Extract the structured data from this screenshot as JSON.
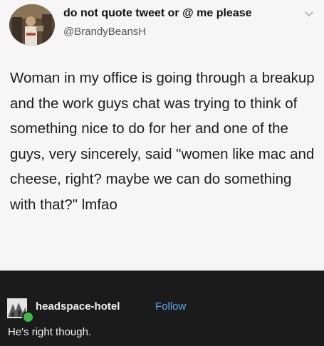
{
  "tweet": {
    "display_name": "do not quote tweet or @ me please",
    "handle": "@BrandyBeansH",
    "text": "Woman in my office is going through a breakup and the work guys chat was trying to think of something nice to do for her and one of the guys, very sincerely, said \"women like mac and cheese, right? maybe we can do something with that?\" lmfao"
  },
  "reblog": {
    "username": "headspace-hotel",
    "follow_label": "Follow",
    "comment": "He's right though."
  },
  "colors": {
    "tweet_background": "#f6f6f6",
    "dark_background": "#1b1b1b",
    "follow_link": "#5aa9f2",
    "badge_green": "#3eb94a"
  }
}
